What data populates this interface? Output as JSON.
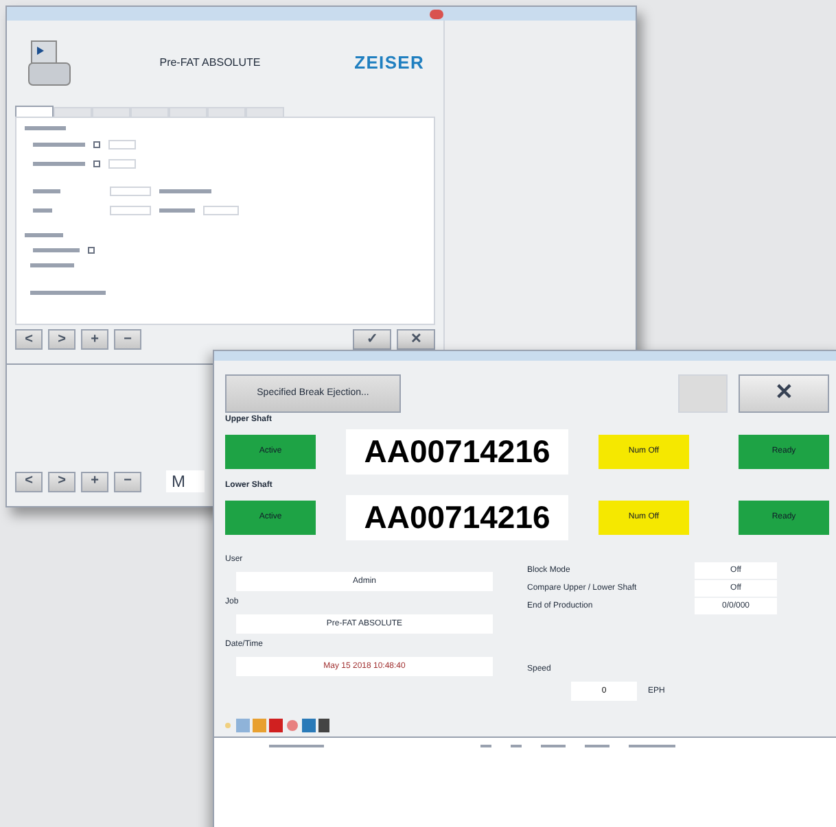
{
  "back_window": {
    "header_title": "Pre-FAT ABSOLUTE",
    "logo": "ZEISER",
    "tabs": [
      {
        "selected": true
      },
      {
        "selected": false
      },
      {
        "selected": false
      },
      {
        "selected": false
      },
      {
        "selected": false
      },
      {
        "selected": false
      },
      {
        "selected": false
      }
    ],
    "checkboxes": [
      {
        "checked": false
      },
      {
        "checked": false
      },
      {
        "checked": false
      }
    ],
    "nav_buttons": [
      "<",
      ">",
      "+",
      "−"
    ],
    "confirm_buttons": [
      "✓",
      "✕"
    ],
    "lower_nav_buttons": [
      "<",
      ">",
      "+",
      "−"
    ],
    "lower_partial_text": "M"
  },
  "front_window": {
    "eject_button": "Specified Break Ejection...",
    "close_button": "✕",
    "shafts": [
      {
        "label": "Upper Shaft",
        "status": "Active",
        "code": "AA00714216",
        "num_state": "Num Off",
        "ready": "Ready"
      },
      {
        "label": "Lower Shaft",
        "status": "Active",
        "code": "AA00714216",
        "num_state": "Num Off",
        "ready": "Ready"
      }
    ],
    "fields": [
      {
        "label": "User",
        "value": "Admin"
      },
      {
        "label": "Job",
        "value": "Pre-FAT ABSOLUTE"
      },
      {
        "label": "Date/Time",
        "value": "May 15 2018   10:48:40"
      }
    ],
    "settings": [
      {
        "label": "Block Mode",
        "value": "Off"
      },
      {
        "label": "Compare Upper / Lower Shaft",
        "value": "Off"
      },
      {
        "label": "End of Production",
        "value": "0/0/000"
      }
    ],
    "speed": {
      "label": "Speed",
      "value": "0",
      "unit": "EPH"
    }
  }
}
